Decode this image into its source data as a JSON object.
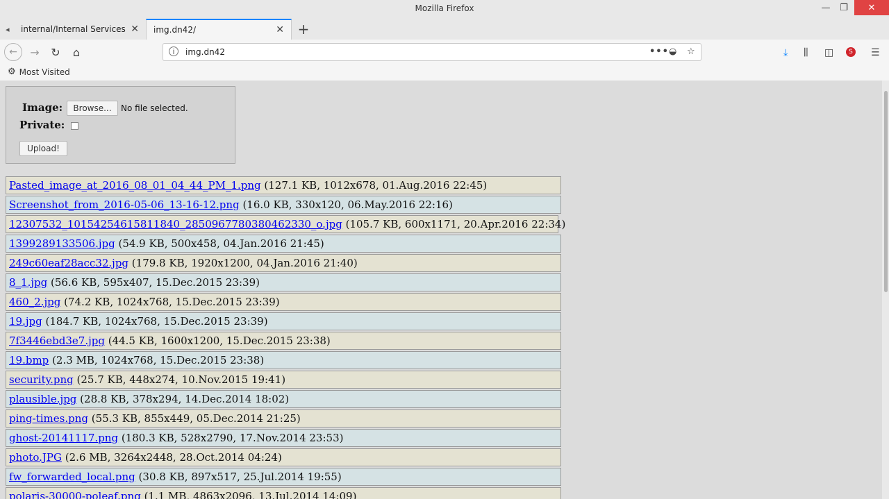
{
  "window": {
    "title": "Mozilla Firefox",
    "controls": {
      "minimize": "—",
      "maximize": "❐",
      "close": "✕"
    }
  },
  "tabs": [
    {
      "label": "internal/Internal Services",
      "icon": "tab-favicon-icon",
      "active": false
    },
    {
      "label": "img.dn42/",
      "active": true
    }
  ],
  "toolbar": {
    "url": "img.dn42",
    "icons": [
      "back-icon",
      "forward-icon",
      "reload-icon",
      "home-icon",
      "page-actions-icon",
      "pocket-icon",
      "bookmark-star-icon",
      "download-icon",
      "library-icon",
      "sidebar-icon",
      "extension-icon",
      "menu-icon"
    ],
    "accent": "#0a84ff"
  },
  "bookmarks": {
    "most_visited": "Most Visited"
  },
  "upload_form": {
    "image_label": "Image:",
    "browse_label": "Browse...",
    "no_file": "No file selected.",
    "private_label": "Private:",
    "upload_label": "Upload!"
  },
  "files": [
    {
      "name": "Pasted_image_at_2016_08_01_04_44_PM_1.png",
      "info": " (127.1 KB, 1012x678, 01.Aug.2016 22:45)"
    },
    {
      "name": "Screenshot_from_2016-05-06_13-16-12.png",
      "info": " (16.0 KB, 330x120, 06.May.2016 22:16)"
    },
    {
      "name": "12307532_10154254615811840_2850967780380462330_o.jpg",
      "info": " (105.7 KB, 600x1171, 20.Apr.2016 22:34)"
    },
    {
      "name": "1399289133506.jpg",
      "info": " (54.9 KB, 500x458, 04.Jan.2016 21:45)"
    },
    {
      "name": "249c60eaf28acc32.jpg",
      "info": " (179.8 KB, 1920x1200, 04.Jan.2016 21:40)"
    },
    {
      "name": "8_1.jpg",
      "info": " (56.6 KB, 595x407, 15.Dec.2015 23:39)"
    },
    {
      "name": "460_2.jpg",
      "info": " (74.2 KB, 1024x768, 15.Dec.2015 23:39)"
    },
    {
      "name": "19.jpg",
      "info": " (184.7 KB, 1024x768, 15.Dec.2015 23:39)"
    },
    {
      "name": "7f3446ebd3e7.jpg",
      "info": " (44.5 KB, 1600x1200, 15.Dec.2015 23:38)"
    },
    {
      "name": "19.bmp",
      "info": " (2.3 MB, 1024x768, 15.Dec.2015 23:38)"
    },
    {
      "name": "security.png",
      "info": " (25.7 KB, 448x274, 10.Nov.2015 19:41)"
    },
    {
      "name": "plausible.jpg",
      "info": " (28.8 KB, 378x294, 14.Dec.2014 18:02)"
    },
    {
      "name": "ping-times.png",
      "info": " (55.3 KB, 855x449, 05.Dec.2014 21:25)"
    },
    {
      "name": "ghost-20141117.png",
      "info": " (180.3 KB, 528x2790, 17.Nov.2014 23:53)"
    },
    {
      "name": "photo.JPG",
      "info": " (2.6 MB, 3264x2448, 28.Oct.2014 04:24)"
    },
    {
      "name": "fw_forwarded_local.png",
      "info": " (30.8 KB, 897x517, 25.Jul.2014 19:55)"
    },
    {
      "name": "polaris-30000-poleaf.png",
      "info": " (1.1 MB, 4863x2096, 13.Jul.2014 14:09)"
    }
  ]
}
